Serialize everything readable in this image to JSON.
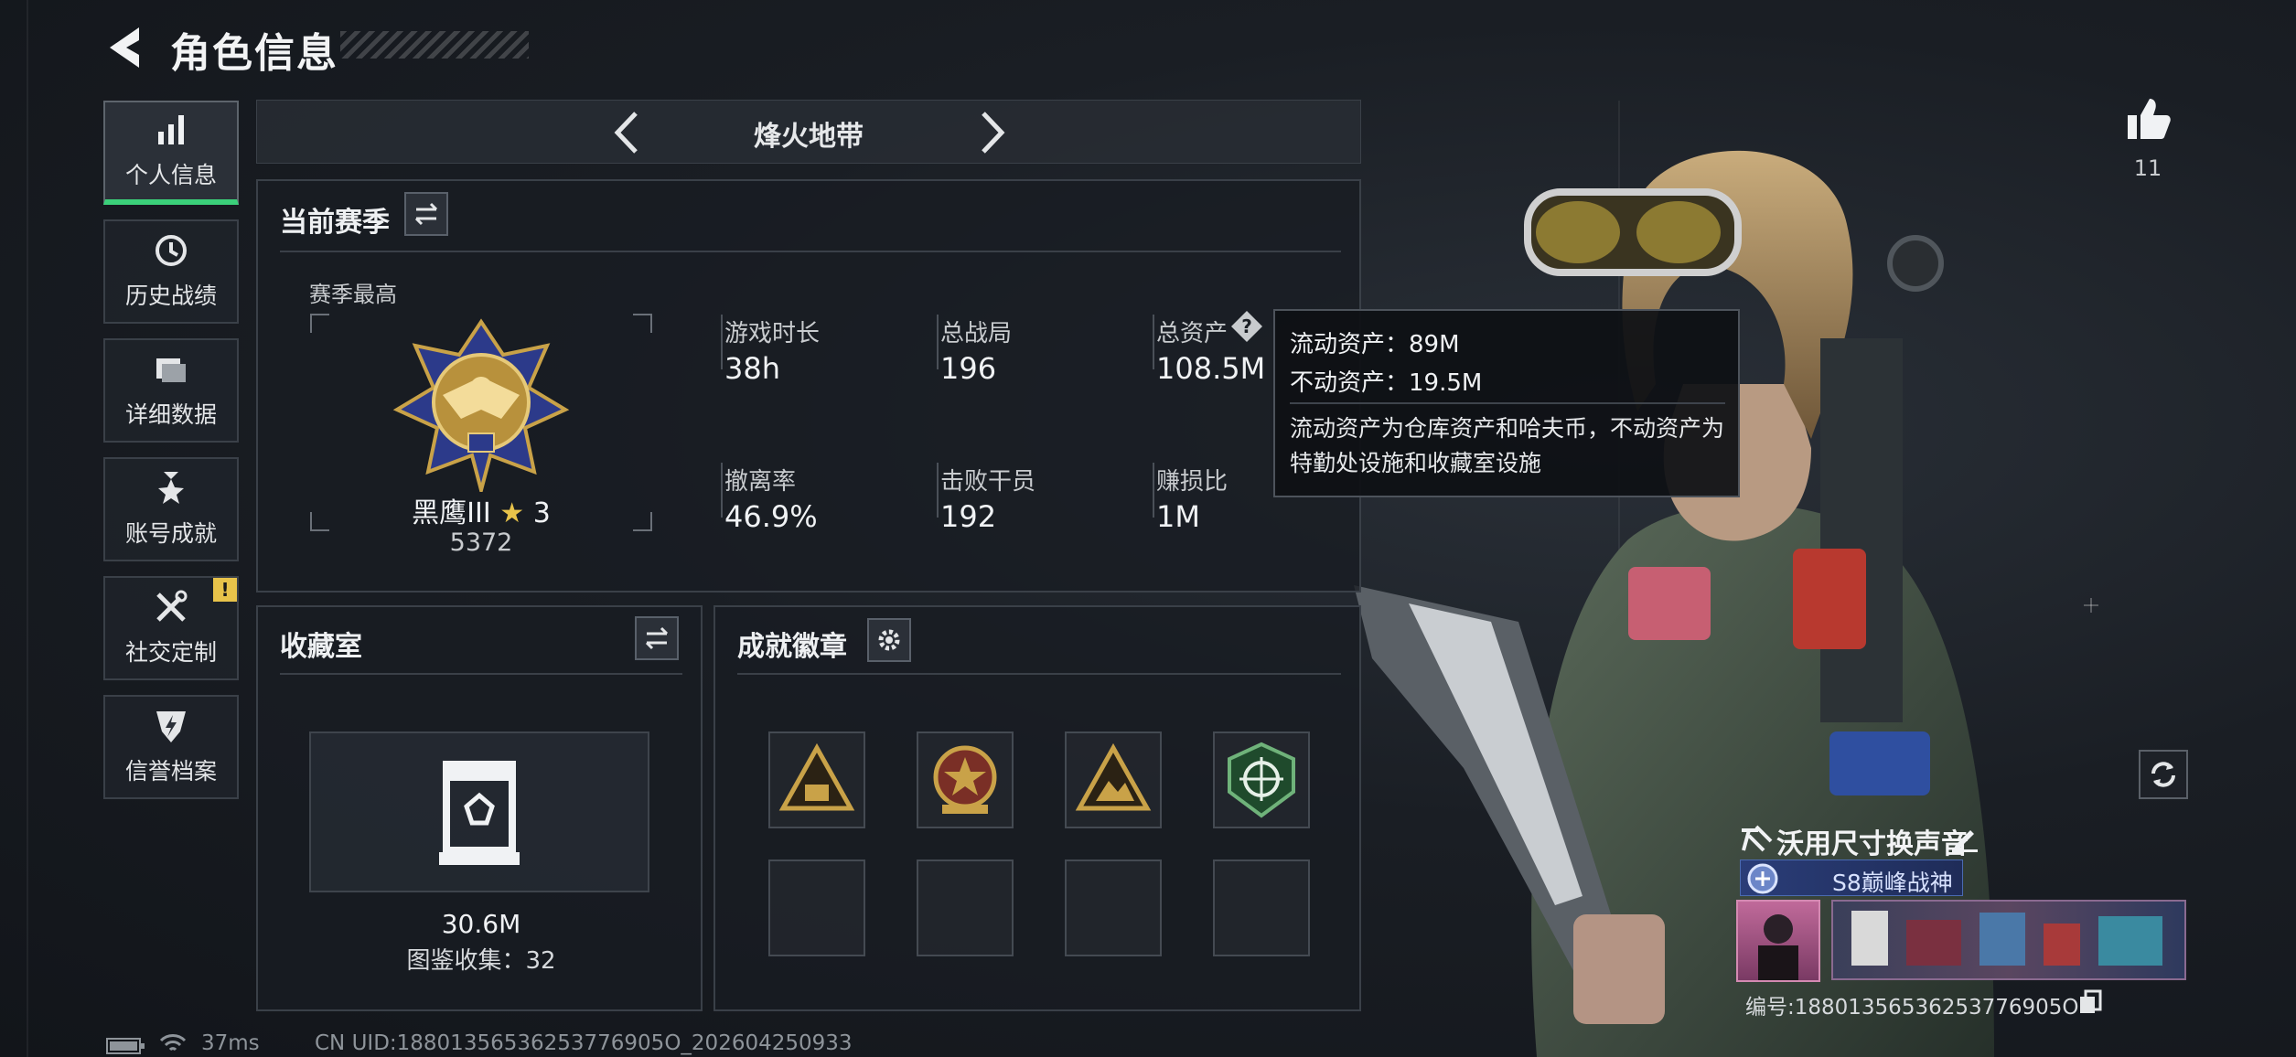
{
  "header": {
    "title": "角色信息"
  },
  "sidebar": {
    "items": [
      {
        "label": "个人信息",
        "icon": "bar-chart-icon",
        "active": true
      },
      {
        "label": "历史战绩",
        "icon": "clock-icon"
      },
      {
        "label": "详细数据",
        "icon": "folder-icon"
      },
      {
        "label": "账号成就",
        "icon": "medal-icon"
      },
      {
        "label": "社交定制",
        "icon": "tools-icon",
        "badge": "!"
      },
      {
        "label": "信誉档案",
        "icon": "shield-icon"
      }
    ]
  },
  "mode": {
    "title": "烽火地带"
  },
  "season": {
    "title": "当前赛季",
    "best_label": "赛季最高",
    "rank_name": "黑鹰III",
    "rank_star": "3",
    "rank_score": "5372",
    "stats": [
      {
        "label": "游戏时长",
        "value": "38h"
      },
      {
        "label": "总战局",
        "value": "196"
      },
      {
        "label": "总资产",
        "value": "108.5M",
        "help": true
      },
      {
        "label": "撤离率",
        "value": "46.9%"
      },
      {
        "label": "击败干员",
        "value": "192"
      },
      {
        "label": "赚损比",
        "value": "1M"
      }
    ]
  },
  "tooltip": {
    "liquid": "流动资产：89M",
    "fixed": "不动资产：19.5M",
    "desc": "流动资产为仓库资产和哈夫币，不动资产为特勤处设施和收藏室设施"
  },
  "collection": {
    "title": "收藏室",
    "value": "30.6M",
    "catalog": "图鉴收集：32"
  },
  "achievements": {
    "title": "成就徽章",
    "slots": 8,
    "filled": 4
  },
  "like": {
    "count": "11"
  },
  "player": {
    "name": "沃用尺寸换声音",
    "season_title": "S8巅峰战神",
    "id_text": "编号:18801356536253776905O"
  },
  "footer": {
    "ping": "37ms",
    "uid": "CN UID:18801356536253776905O_202604250933"
  },
  "colors": {
    "accent": "#3bd07a",
    "badge": "#e8c34a",
    "gold": "#c9a248"
  }
}
